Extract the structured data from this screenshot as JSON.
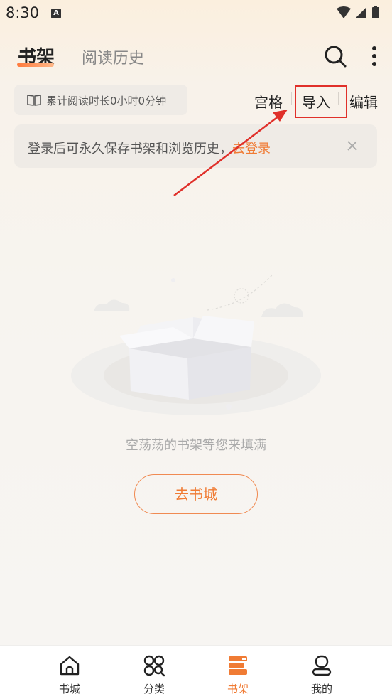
{
  "status_bar": {
    "time": "8:30",
    "notification_badge": "A"
  },
  "header": {
    "tabs": [
      {
        "label": "书架",
        "active": true
      },
      {
        "label": "阅读历史",
        "active": false
      }
    ],
    "icons": [
      "search-icon",
      "more-vertical-icon"
    ]
  },
  "reading_stats": {
    "text": "累计阅读时长0小时0分钟",
    "icon": "book-icon"
  },
  "actions": {
    "grid": "宫格",
    "import": "导入",
    "edit": "编辑"
  },
  "login_banner": {
    "message": "登录后可永久保存书架和浏览历史，",
    "link": "去登录",
    "close_icon": "close-icon"
  },
  "empty_state": {
    "text": "空荡荡的书架等您来填满",
    "button": "去书城"
  },
  "bottom_nav": [
    {
      "label": "书城",
      "icon": "home-icon",
      "active": false
    },
    {
      "label": "分类",
      "icon": "category-icon",
      "active": false
    },
    {
      "label": "书架",
      "icon": "bookshelf-icon",
      "active": true
    },
    {
      "label": "我的",
      "icon": "profile-icon",
      "active": false
    }
  ],
  "colors": {
    "accent": "#f07b34",
    "highlight": "#e0302a"
  }
}
